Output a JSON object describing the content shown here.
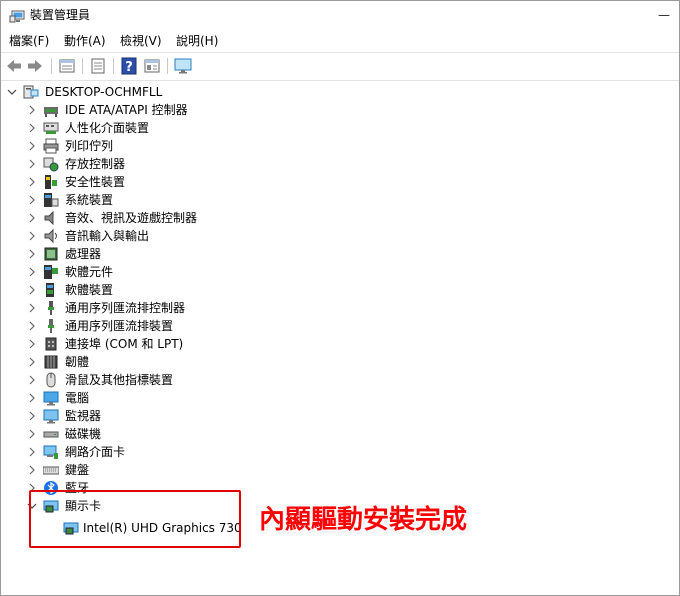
{
  "window": {
    "title": "裝置管理員",
    "controls": [
      "—"
    ]
  },
  "menu": [
    "檔案(F)",
    "動作(A)",
    "檢視(V)",
    "說明(H)"
  ],
  "toolbar": [
    "back-icon",
    "forward-icon",
    "properties-icon",
    "list-icon",
    "help-icon",
    "view-icon",
    "monitor-icon"
  ],
  "tree": {
    "root": "DESKTOP-OCHMFLL",
    "categories": [
      {
        "label": "IDE ATA/ATAPI 控制器",
        "icon": "ide-controller-icon"
      },
      {
        "label": "人性化介面裝置",
        "icon": "hid-icon"
      },
      {
        "label": "列印佇列",
        "icon": "printer-icon"
      },
      {
        "label": "存放控制器",
        "icon": "storage-controller-icon"
      },
      {
        "label": "安全性裝置",
        "icon": "security-device-icon"
      },
      {
        "label": "系統裝置",
        "icon": "system-device-icon"
      },
      {
        "label": "音效、視訊及遊戲控制器",
        "icon": "sound-icon"
      },
      {
        "label": "音訊輸入與輸出",
        "icon": "audio-io-icon"
      },
      {
        "label": "處理器",
        "icon": "processor-icon"
      },
      {
        "label": "軟體元件",
        "icon": "software-component-icon"
      },
      {
        "label": "軟體裝置",
        "icon": "software-device-icon"
      },
      {
        "label": "通用序列匯流排控制器",
        "icon": "usb-controller-icon"
      },
      {
        "label": "通用序列匯流排裝置",
        "icon": "usb-device-icon"
      },
      {
        "label": "連接埠 (COM 和 LPT)",
        "icon": "port-icon"
      },
      {
        "label": "韌體",
        "icon": "firmware-icon"
      },
      {
        "label": "滑鼠及其他指標裝置",
        "icon": "mouse-icon"
      },
      {
        "label": "電腦",
        "icon": "computer-icon"
      },
      {
        "label": "監視器",
        "icon": "monitor-icon"
      },
      {
        "label": "磁碟機",
        "icon": "disk-drive-icon"
      },
      {
        "label": "網路介面卡",
        "icon": "network-adapter-icon"
      },
      {
        "label": "鍵盤",
        "icon": "keyboard-icon"
      },
      {
        "label": "藍牙",
        "icon": "bluetooth-icon"
      },
      {
        "label": "顯示卡",
        "icon": "display-adapter-icon",
        "expanded": true,
        "children": [
          "Intel(R) UHD Graphics 730"
        ]
      }
    ]
  },
  "annotation": "內顯驅動安裝完成",
  "colors": {
    "annotation": "#ff0000",
    "highlight_box": "#e00000"
  }
}
